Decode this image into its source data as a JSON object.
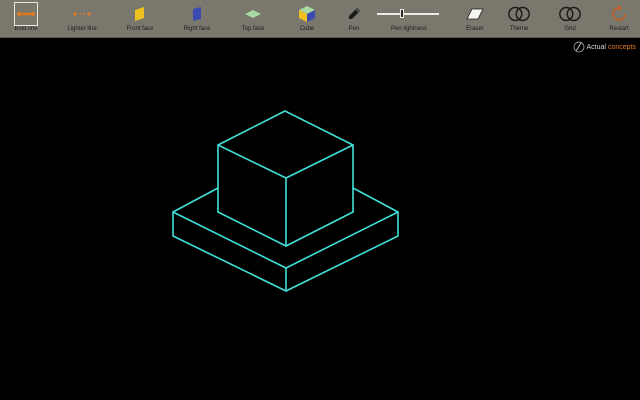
{
  "toolbar": {
    "tools": [
      {
        "id": "bold",
        "label": "Bold line",
        "icon": "bold-line-icon"
      },
      {
        "id": "lighter",
        "label": "Lighter line",
        "icon": "lighter-line-icon"
      },
      {
        "id": "front",
        "label": "Front face",
        "icon": "front-face-icon"
      },
      {
        "id": "right",
        "label": "Right face",
        "icon": "right-face-icon"
      },
      {
        "id": "top",
        "label": "Top face",
        "icon": "top-face-icon"
      },
      {
        "id": "cube",
        "label": "Cube",
        "icon": "cube-icon"
      },
      {
        "id": "pen",
        "label": "Pen",
        "icon": "pen-icon"
      },
      {
        "id": "eraser",
        "label": "Eraser",
        "icon": "eraser-icon"
      },
      {
        "id": "theme",
        "label": "Theme",
        "icon": "theme-icon"
      },
      {
        "id": "grid",
        "label": "Grid",
        "icon": "grid-icon"
      },
      {
        "id": "restart",
        "label": "Restart",
        "icon": "restart-icon"
      }
    ],
    "selected_tool": "bold",
    "pen_lightness": {
      "label": "Pen lightness",
      "value": 0.4
    }
  },
  "brand": {
    "part1": "Actual",
    "part2": "concepts"
  },
  "colors": {
    "toolbar_bg": "#7a786c",
    "canvas_bg": "#000000",
    "drawing_stroke": "#40e0d8",
    "orange": "#e07a22",
    "front_face": "#f0c020",
    "right_face": "#3a4ab0",
    "top_face": "#a8d8a0"
  }
}
